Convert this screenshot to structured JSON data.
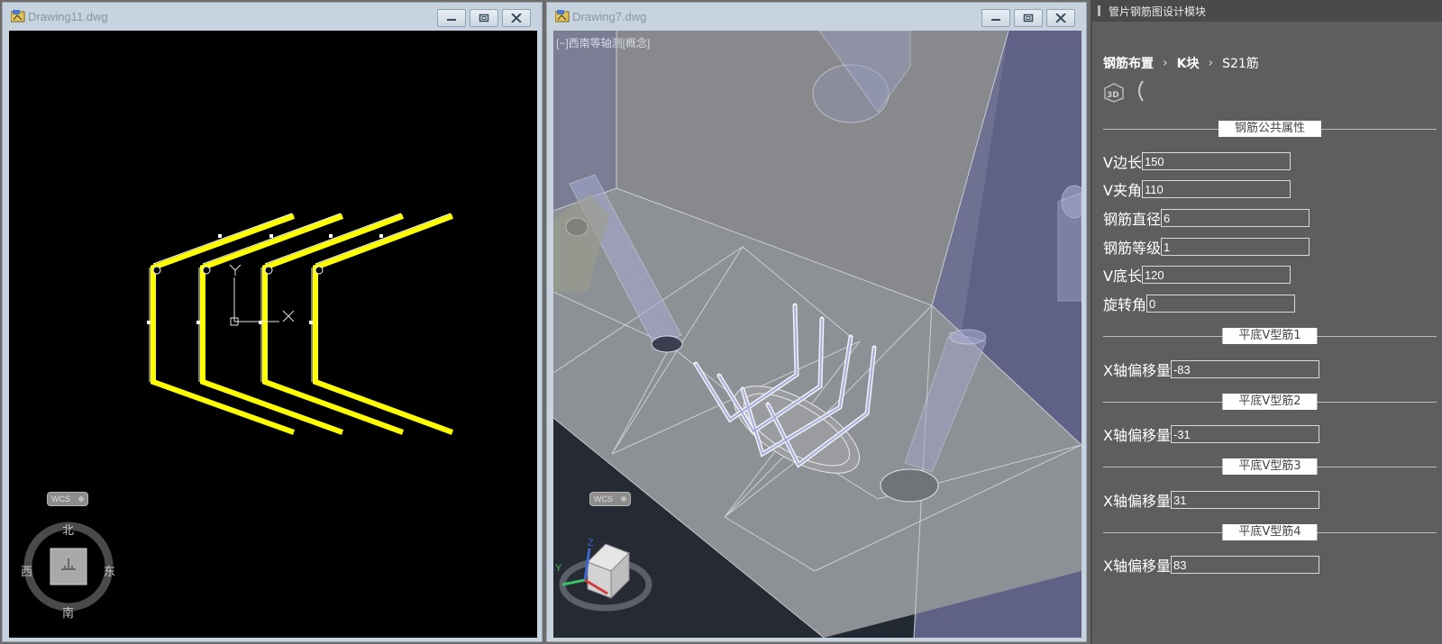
{
  "windows": {
    "left": {
      "title": "Drawing11.dwg",
      "wcs_label": "WCS",
      "compass": {
        "north": "北",
        "south": "南",
        "east": "东",
        "west": "西"
      },
      "ucs": {
        "y_label": "Y",
        "x_label": "X"
      }
    },
    "right": {
      "title": "Drawing7.dwg",
      "wcs_label": "WCS",
      "view_label": "[−]西南等轴测[概念]"
    }
  },
  "panel": {
    "title": "管片钢筋图设计模块",
    "breadcrumb": {
      "item1": "钢筋布置",
      "item2": "K块",
      "item3": "S21筋"
    },
    "sections": {
      "common": "钢筋公共属性",
      "v1": "平底V型筋1",
      "v2": "平底V型筋2",
      "v3": "平底V型筋3",
      "v4": "平底V型筋4"
    },
    "props": {
      "v_side_len": {
        "label": "V边长",
        "value": "150"
      },
      "v_angle": {
        "label": "V夹角",
        "value": "110"
      },
      "diameter": {
        "label": "钢筋直径",
        "value": "6"
      },
      "grade": {
        "label": "钢筋等级",
        "value": "1"
      },
      "v_bottom_len": {
        "label": "V底长",
        "value": "120"
      },
      "rotation": {
        "label": "旋转角",
        "value": "0"
      },
      "x_offset_1": {
        "label": "X轴偏移量",
        "value": "-83"
      },
      "x_offset_2": {
        "label": "X轴偏移量",
        "value": "-31"
      },
      "x_offset_3": {
        "label": "X轴偏移量",
        "value": "31"
      },
      "x_offset_4": {
        "label": "X轴偏移量",
        "value": "83"
      }
    }
  },
  "colors": {
    "rebar_yellow": "#ffff00",
    "panel_bg": "#5e5e5e",
    "viewport_left_bg": "#000000",
    "concrete_gray": "#8b8e92",
    "pipe_lavender": "#9a9fcc"
  },
  "icons": [
    "drawing-app-icon",
    "minimize-icon",
    "maximize-icon",
    "close-icon",
    "3d-view-icon",
    "arc-icon",
    "view-cube-icon",
    "compass-icon"
  ]
}
